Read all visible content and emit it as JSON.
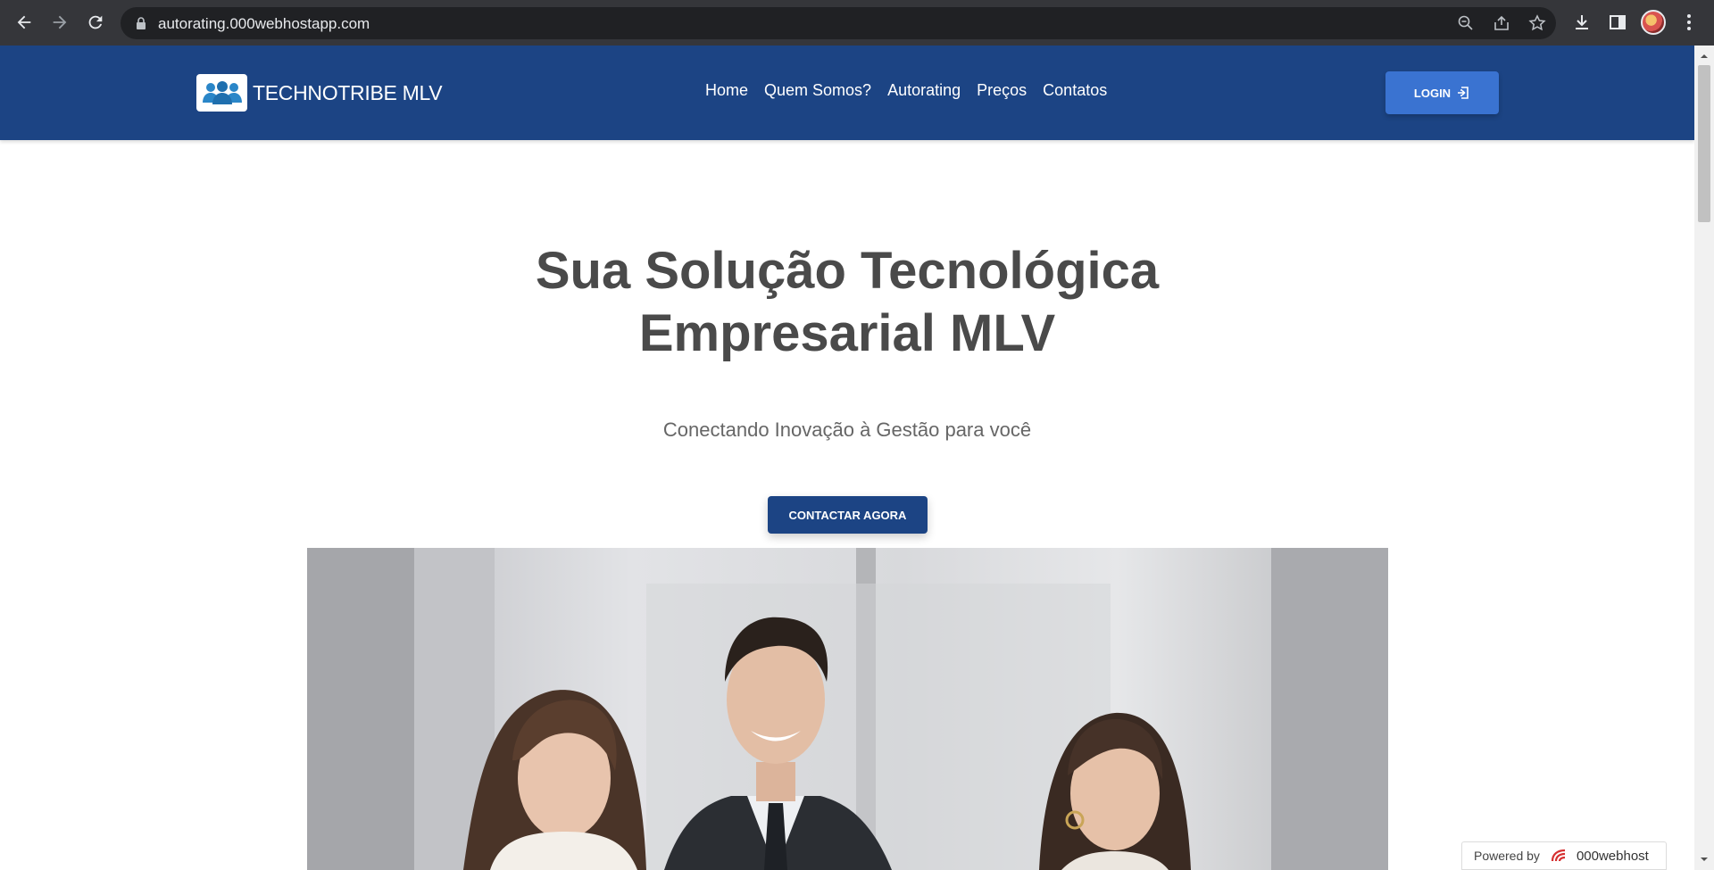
{
  "browser": {
    "url": "autorating.000webhostapp.com",
    "icons": [
      "back-icon",
      "forward-icon",
      "reload-icon",
      "lock-icon",
      "zoom-icon",
      "share-icon",
      "star-icon",
      "download-icon",
      "sidepanel-icon",
      "profile-avatar",
      "menu-icon"
    ]
  },
  "header": {
    "brand_name": "TECHNOTRIBE MLV",
    "nav": [
      {
        "label": "Home"
      },
      {
        "label": "Quem Somos?"
      },
      {
        "label": "Autorating"
      },
      {
        "label": "Preços"
      },
      {
        "label": "Contatos"
      }
    ],
    "login_label": "LOGIN"
  },
  "hero": {
    "title_line1": "Sua Solução Tecnológica",
    "title_line2": "Empresarial MLV",
    "subtitle": "Conectando Inovação à Gestão para você",
    "cta_label": "CONTACTAR AGORA"
  },
  "badge": {
    "prefix": "Powered by",
    "brand": "000webhost"
  },
  "colors": {
    "header_bg": "#1c4484",
    "login_bg": "#3a73d1",
    "cta_bg": "#1c4484",
    "title_color": "#4a4a4a",
    "chrome_bg": "#35363a"
  }
}
